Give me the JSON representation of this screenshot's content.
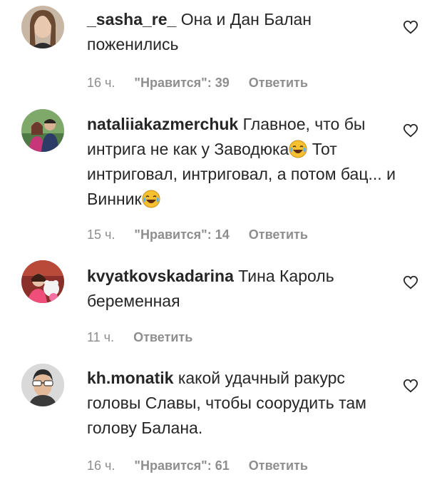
{
  "comments": [
    {
      "username": "_sasha_re_",
      "text": "Она и Дан Балан поженились",
      "time": "16 ч.",
      "likes": "\"Нравится\": 39",
      "reply": "Ответить"
    },
    {
      "username": "nataliiakazmerchuk",
      "text_part1": "Главное, что бы интрига не как у Заводюка",
      "text_part2": "Тот интриговал, интриговал, а потом бац... и Винник",
      "time": "15 ч.",
      "likes": "\"Нравится\": 14",
      "reply": "Ответить"
    },
    {
      "username": "kvyatkovskadarina",
      "text": "Тина Кароль беременная",
      "time": "11 ч.",
      "reply": "Ответить"
    },
    {
      "username": "kh.monatik",
      "text": "какой удачный ракурс головы Славы, чтобы соорудить там голову Балана.",
      "time": "16 ч.",
      "likes": "\"Нравится\": 61",
      "reply": "Ответить"
    }
  ],
  "icons": {
    "heart": "heart-outline-icon",
    "emoji": "face-with-tears-of-joy-emoji"
  },
  "colors": {
    "text": "#262626",
    "meta": "#8e8e8e",
    "emoji": "#f7c02f"
  }
}
